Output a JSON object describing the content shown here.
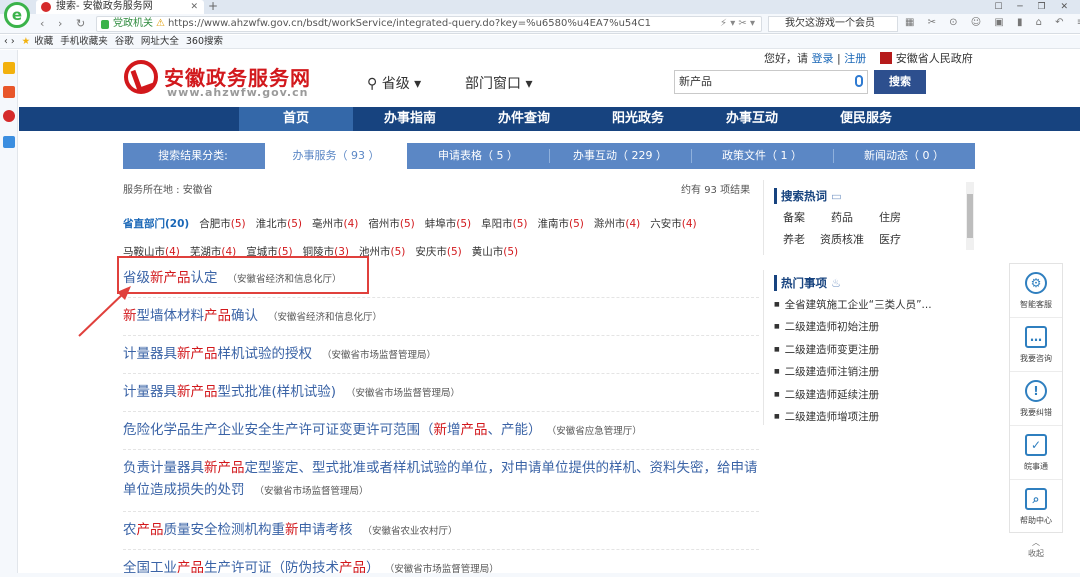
{
  "browser": {
    "tab_title": "搜索- 安徽政务服务网",
    "new_tab": "+",
    "url_prefix": "党政机关",
    "url": "https://www.ahzwfw.gov.cn/bsdt/workService/integrated-query.do?key=%u6580%u4EA7%u54C1",
    "search_text": "我欠这游戏一个会员",
    "bookmarks": [
      "收藏",
      "手机收藏夹",
      "谷歌",
      "网址大全",
      "360搜索"
    ]
  },
  "header": {
    "logo_cn": "安徽政务服务网",
    "logo_en": "www.ahzwfw.gov.cn",
    "location": "省级",
    "dept": "部门窗口",
    "greeting": "您好，请",
    "login": "登录",
    "divider": "|",
    "register": "注册",
    "gov_link": "安徽省人民政府",
    "search_value": "新产品",
    "search_button": "搜索"
  },
  "nav": [
    "首页",
    "办事指南",
    "办件查询",
    "阳光政务",
    "办事互动",
    "便民服务"
  ],
  "category_tabs": [
    "搜索结果分类:",
    "办事服务（ 93 ）",
    "申请表格（ 5 ）",
    "办事互动（ 229 ）",
    "政策文件（ 1 ）",
    "新闻动态（ 0 ）"
  ],
  "service_location": "服务所在地 : 安徽省",
  "result_count": {
    "prefix": "约有",
    "num": "93",
    "suffix": "项结果"
  },
  "filters": [
    {
      "name": "省直部门",
      "count": "(20)"
    },
    {
      "name": "合肥市",
      "count": "(5)"
    },
    {
      "name": "淮北市",
      "count": "(5)"
    },
    {
      "name": "亳州市",
      "count": "(4)"
    },
    {
      "name": "宿州市",
      "count": "(5)"
    },
    {
      "name": "蚌埠市",
      "count": "(5)"
    },
    {
      "name": "阜阳市",
      "count": "(5)"
    },
    {
      "name": "淮南市",
      "count": "(5)"
    },
    {
      "name": "滁州市",
      "count": "(4)"
    },
    {
      "name": "六安市",
      "count": "(4)"
    },
    {
      "name": "马鞍山市",
      "count": "(4)"
    },
    {
      "name": "芜湖市",
      "count": "(4)"
    },
    {
      "name": "宣城市",
      "count": "(5)"
    },
    {
      "name": "铜陵市",
      "count": "(3)"
    },
    {
      "name": "池州市",
      "count": "(5)"
    },
    {
      "name": "安庆市",
      "count": "(5)"
    },
    {
      "name": "黄山市",
      "count": "(5)"
    }
  ],
  "results": [
    {
      "parts": [
        [
          "省级",
          0
        ],
        [
          "新产品",
          1
        ],
        [
          "认定",
          0
        ]
      ],
      "org": "（安徽省经济和信息化厅）"
    },
    {
      "parts": [
        [
          "新",
          1
        ],
        [
          "型墙体材料",
          0
        ],
        [
          "产品",
          1
        ],
        [
          "确认",
          0
        ]
      ],
      "org": "（安徽省经济和信息化厅）"
    },
    {
      "parts": [
        [
          "计量器具",
          0
        ],
        [
          "新产品",
          1
        ],
        [
          "样机试验的授权",
          0
        ]
      ],
      "org": "（安徽省市场监督管理局）"
    },
    {
      "parts": [
        [
          "计量器具",
          0
        ],
        [
          "新产品",
          1
        ],
        [
          "型式批准(样机试验)",
          0
        ]
      ],
      "org": "（安徽省市场监督管理局）"
    },
    {
      "parts": [
        [
          "危险化学品生产企业安全生产许可证变更许可范围（",
          0
        ],
        [
          "新",
          1
        ],
        [
          "增",
          0
        ],
        [
          "产品",
          1
        ],
        [
          "、产能）",
          0
        ]
      ],
      "org": "（安徽省应急管理厅）"
    },
    {
      "parts": [
        [
          "负责计量器具",
          0
        ],
        [
          "新产品",
          1
        ],
        [
          "定型鉴定、型式批准或者样机试验的单位，对申请单位提供的样机、资料失密，给申请单位造成损失的处罚",
          0
        ]
      ],
      "org": "（安徽省市场监督管理局）"
    },
    {
      "parts": [
        [
          "农",
          0
        ],
        [
          "产品",
          1
        ],
        [
          "质量安全检测机构重",
          0
        ],
        [
          "新",
          1
        ],
        [
          "申请考核",
          0
        ]
      ],
      "org": "（安徽省农业农村厅）"
    },
    {
      "parts": [
        [
          "全国工业",
          0
        ],
        [
          "产品",
          1
        ],
        [
          "生产许可证（防伪技术",
          0
        ],
        [
          "产品",
          1
        ],
        [
          "）",
          0
        ]
      ],
      "org": "（安徽省市场监督管理局）"
    }
  ],
  "hot_search": {
    "title": "搜索热词",
    "words": [
      "备案",
      "药品",
      "住房",
      "养老",
      "资质核准",
      "医疗"
    ]
  },
  "hot_items": {
    "title": "热门事项",
    "items": [
      "全省建筑施工企业“三类人员”...",
      "二级建造师初始注册",
      "二级建造师变更注册",
      "二级建造师注销注册",
      "二级建造师延续注册",
      "二级建造师增项注册"
    ]
  },
  "side": [
    "智能客服",
    "我要咨询",
    "我要纠错",
    "皖事通",
    "帮助中心",
    "收起"
  ]
}
